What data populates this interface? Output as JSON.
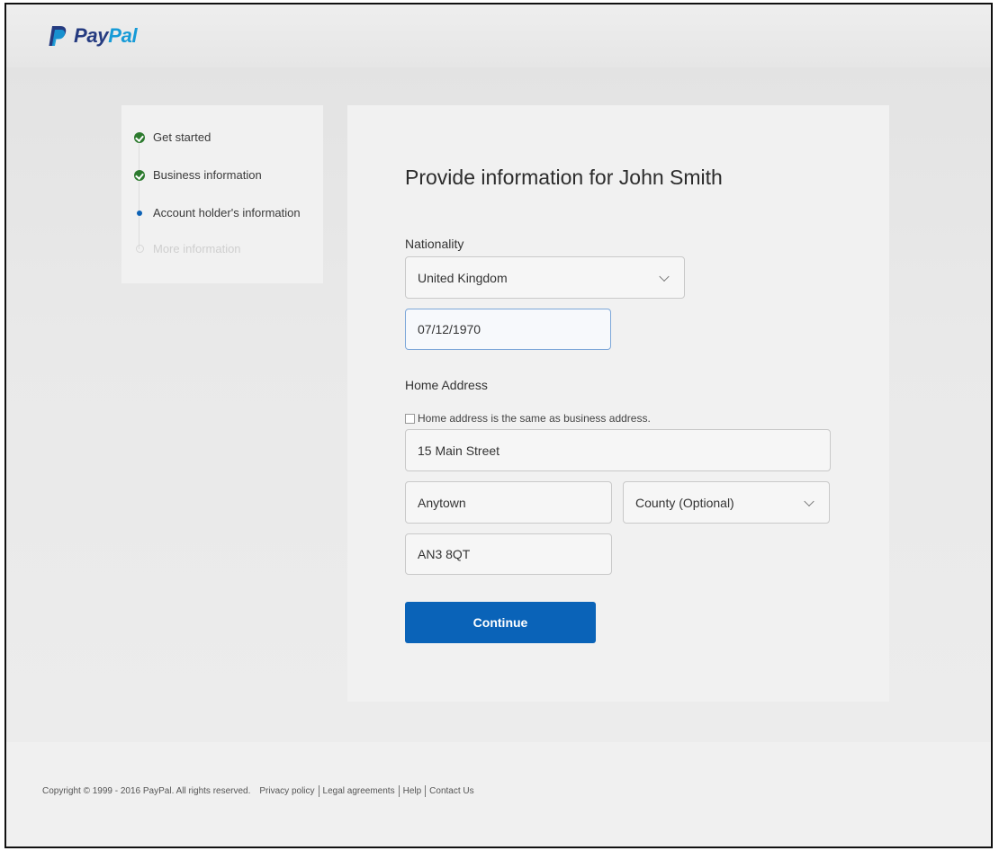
{
  "brand": {
    "name_pay": "Pay",
    "name_pal": "Pal",
    "icon": "paypal-logo-icon"
  },
  "steps": [
    {
      "label": "Get started",
      "state": "complete"
    },
    {
      "label": "Business information",
      "state": "complete"
    },
    {
      "label": "Account holder's information",
      "state": "current"
    },
    {
      "label": "More information",
      "state": "upcoming"
    }
  ],
  "form": {
    "title": "Provide information for John Smith",
    "nationality_label": "Nationality",
    "nationality_value": "United Kingdom",
    "dob_value": "07/12/1970",
    "home_address_label": "Home Address",
    "same_address_label": "Home address is the same as business address.",
    "same_address_checked": false,
    "street_value": "15 Main Street",
    "town_value": "Anytown",
    "county_placeholder": "County (Optional)",
    "postcode_value": "AN3 8QT",
    "continue_label": "Continue"
  },
  "footer": {
    "copyright": "Copyright © 1999 - 2016 PayPal. All rights reserved.",
    "links": [
      "Privacy policy",
      "Legal agreements",
      "Help",
      "Contact Us"
    ]
  },
  "colors": {
    "accent": "#0a63b8",
    "complete": "#2c7a2e",
    "brand_dark": "#253b80",
    "brand_light": "#179bd7"
  }
}
